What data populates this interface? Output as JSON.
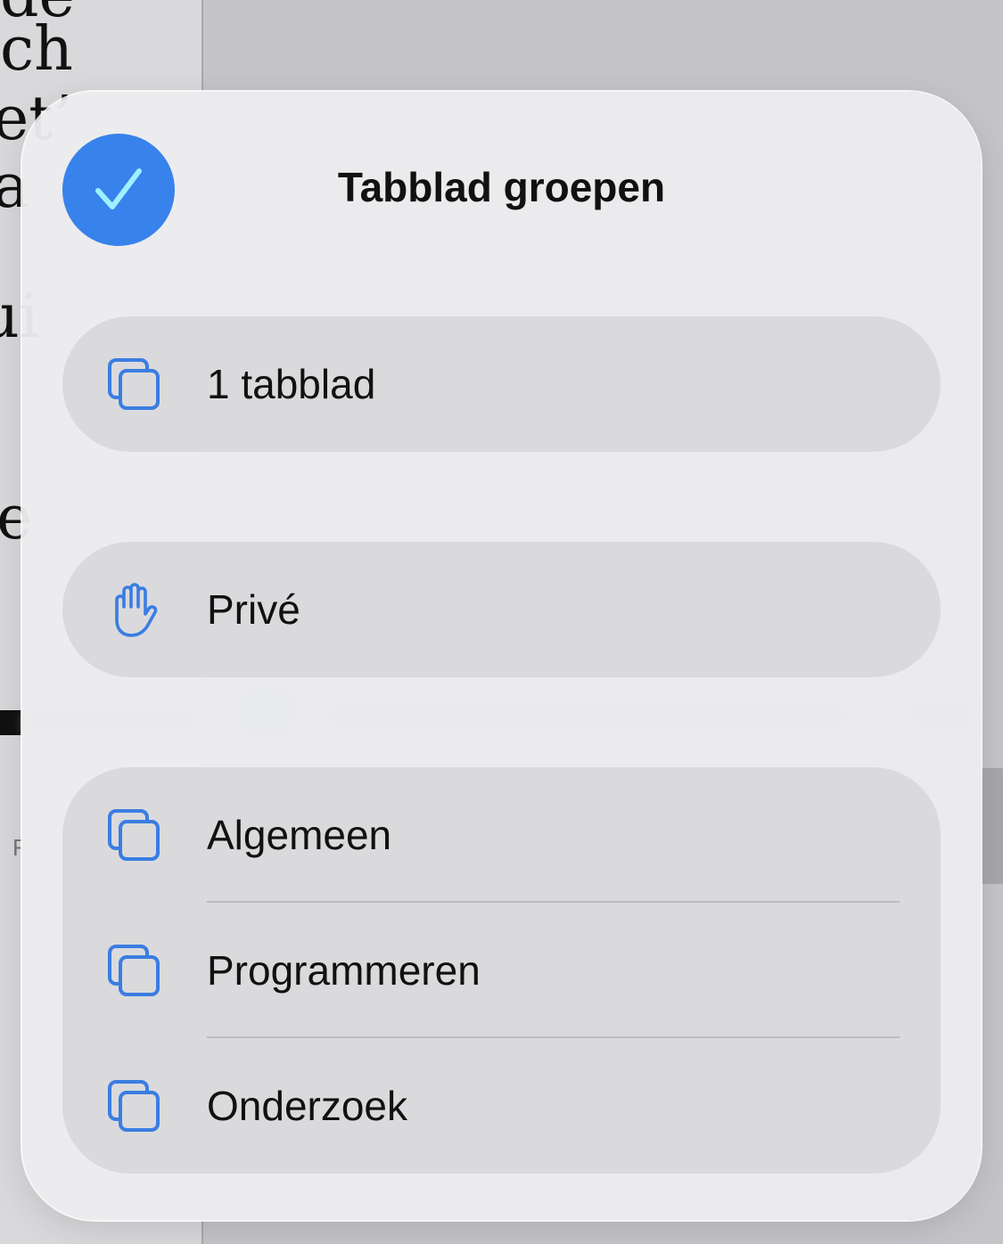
{
  "background": {
    "text_fragments": [
      "de",
      "ch",
      "et’",
      "a",
      "ui",
      "e"
    ],
    "partial_letter": "F"
  },
  "popover": {
    "title": "Tabblad groepen",
    "check_icon": "checkmark-icon",
    "accent_color": "#3882ec",
    "groups": [
      {
        "items": [
          {
            "label": "1 tabblad",
            "icon": "tabs-icon"
          }
        ]
      },
      {
        "items": [
          {
            "label": "Privé",
            "icon": "hand-raised-icon"
          }
        ]
      },
      {
        "items": [
          {
            "label": "Algemeen",
            "icon": "tabs-icon"
          },
          {
            "label": "Programmeren",
            "icon": "tabs-icon"
          },
          {
            "label": "Onderzoek",
            "icon": "tabs-icon"
          }
        ]
      }
    ]
  }
}
